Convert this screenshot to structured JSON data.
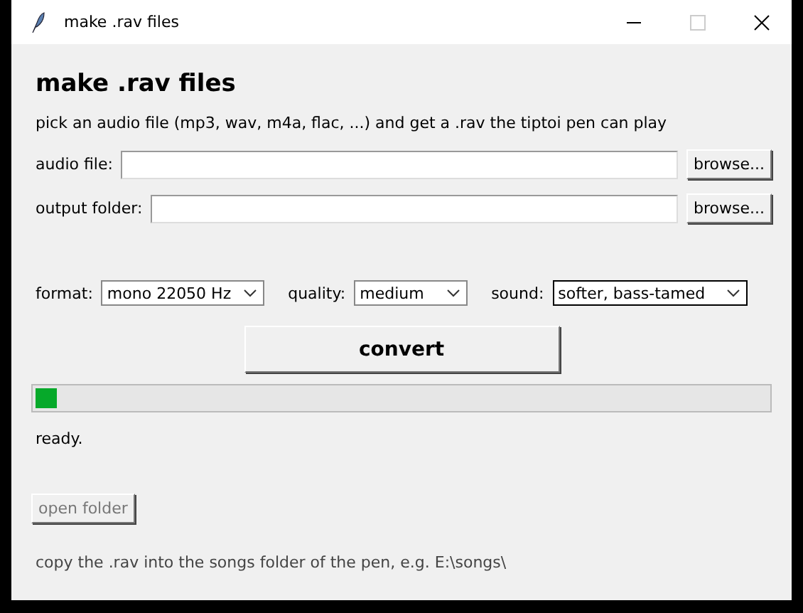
{
  "window": {
    "title": "make .rav files"
  },
  "heading": "make .rav files",
  "subtitle": "pick an audio file (mp3, wav, m4a, flac, ...) and get a .rav the tiptoi pen can play",
  "fields": [
    {
      "label": "audio file:",
      "button": "browse..."
    },
    {
      "label": "output folder:",
      "button": "browse..."
    }
  ],
  "options": [
    {
      "label": "format:",
      "value": "mono 22050 Hz",
      "focused": false
    },
    {
      "label": "quality:",
      "value": "medium",
      "focused": false
    },
    {
      "label": "sound:",
      "value": "softer, bass-tamed",
      "focused": true
    }
  ],
  "convert_button": "convert",
  "progress": {
    "level": 0.03
  },
  "status": "ready.",
  "open_folder_button": {
    "label": "open folder",
    "disabled": true
  },
  "hint": "copy the .rav into the songs folder of the pen, e.g. E:\\songs\\"
}
